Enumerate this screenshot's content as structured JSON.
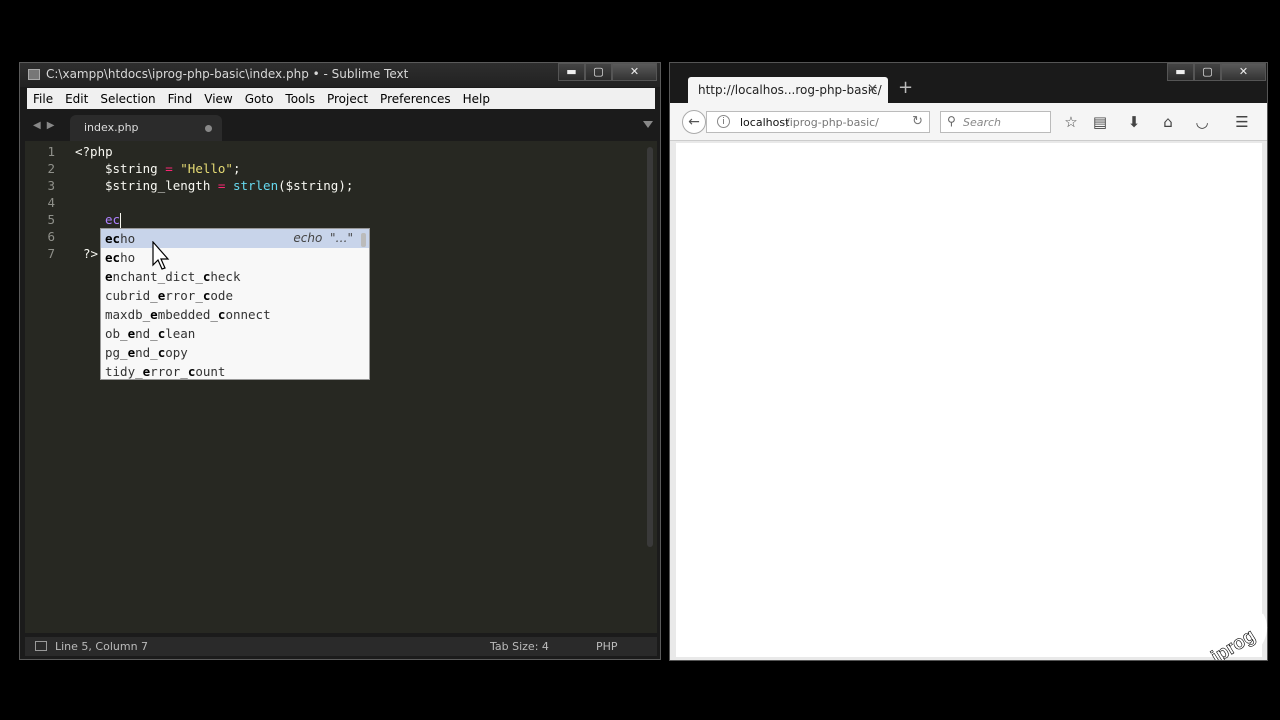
{
  "sublime": {
    "title": "C:\\xampp\\htdocs\\iprog-php-basic\\index.php • - Sublime Text",
    "window_buttons": {
      "minimize": "▬",
      "maximize": "▢",
      "close": "✕"
    },
    "menu": [
      "File",
      "Edit",
      "Selection",
      "Find",
      "View",
      "Goto",
      "Tools",
      "Project",
      "Preferences",
      "Help"
    ],
    "tab": {
      "label": "index.php"
    },
    "line_numbers": [
      "1",
      "2",
      "3",
      "4",
      "5",
      "6",
      "7"
    ],
    "code": {
      "line1": "<?php",
      "line2_var": "$string",
      "line2_op": "=",
      "line2_str": "\"Hello\"",
      "line2_end": ";",
      "line3_var": "$string_length",
      "line3_op": "=",
      "line3_fn": "strlen",
      "line3_args": "($string);",
      "line5_typed": "ec",
      "line7": "?>"
    },
    "autocomplete": {
      "selected_hint": "echo  \"…\"",
      "items": [
        {
          "bold": "ec",
          "rest": "ho"
        },
        {
          "bold": "ec",
          "rest": "ho"
        },
        {
          "pre": "",
          "b1": "e",
          "mid": "nchant_dict_",
          "b2": "c",
          "post": "heck"
        },
        {
          "pre": "cubrid_",
          "b1": "e",
          "mid": "rror_",
          "b2": "c",
          "post": "ode"
        },
        {
          "pre": "maxdb_",
          "b1": "e",
          "mid": "mbedded_",
          "b2": "c",
          "post": "onnect"
        },
        {
          "pre": "ob_",
          "b1": "e",
          "mid": "nd_",
          "b2": "c",
          "post": "lean"
        },
        {
          "pre": "pg_",
          "b1": "e",
          "mid": "nd_",
          "b2": "c",
          "post": "opy"
        },
        {
          "pre": "tidy_",
          "b1": "e",
          "mid": "rror_",
          "b2": "c",
          "post": "ount"
        }
      ]
    },
    "status": {
      "position": "Line 5, Column 7",
      "tab_size": "Tab Size: 4",
      "syntax": "PHP"
    }
  },
  "firefox": {
    "tab_title": "http://localhos...rog-php-basic/",
    "tab_close": "✕",
    "new_tab": "+",
    "url_host": "localhost",
    "url_path": "/iprog-php-basic/",
    "search_placeholder": "Search",
    "window_buttons": {
      "minimize": "▬",
      "maximize": "▢",
      "close": "✕"
    }
  },
  "logo": {
    "text": "iprog"
  }
}
